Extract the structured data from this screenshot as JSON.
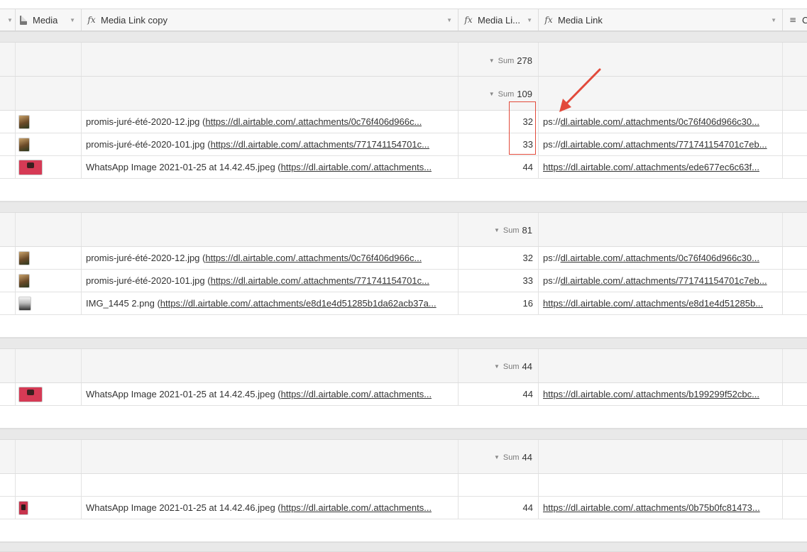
{
  "columns": {
    "media": "Media",
    "media_link_copy": "Media Link copy",
    "media_length": "Media Li...",
    "media_link": "Media Link",
    "last": "C"
  },
  "sum_label": "Sum",
  "groups": [
    {
      "sum": "278"
    },
    {
      "sum": "109",
      "rows": [
        {
          "name": "promis-juré-été-2020-12.jpg (",
          "link": "https://dl.airtable.com/.attachments/0c76f406d966c...",
          "length": "32",
          "media_link_prefix": "ps://",
          "media_link": "dl.airtable.com/.attachments/0c76f406d966c30..."
        },
        {
          "name": "promis-juré-été-2020-101.jpg (",
          "link": "https://dl.airtable.com/.attachments/771741154701c...",
          "length": "33",
          "media_link_prefix": "ps://",
          "media_link": "dl.airtable.com/.attachments/771741154701c7eb..."
        },
        {
          "name": "WhatsApp Image 2021-01-25 at 14.42.45.jpeg (",
          "link": "https://dl.airtable.com/.attachments...",
          "length": "44",
          "media_link_prefix": "",
          "media_link": "https://dl.airtable.com/.attachments/ede677ec6c63f..."
        }
      ]
    },
    {
      "sum": "81",
      "rows": [
        {
          "name": "promis-juré-été-2020-12.jpg (",
          "link": "https://dl.airtable.com/.attachments/0c76f406d966c...",
          "length": "32",
          "media_link_prefix": "ps://",
          "media_link": "dl.airtable.com/.attachments/0c76f406d966c30..."
        },
        {
          "name": "promis-juré-été-2020-101.jpg (",
          "link": "https://dl.airtable.com/.attachments/771741154701c...",
          "length": "33",
          "media_link_prefix": "ps://",
          "media_link": "dl.airtable.com/.attachments/771741154701c7eb..."
        },
        {
          "name": "IMG_1445 2.png (",
          "link": "https://dl.airtable.com/.attachments/e8d1e4d51285b1da62acb37a...",
          "length": "16",
          "media_link_prefix": "",
          "media_link": "https://dl.airtable.com/.attachments/e8d1e4d51285b..."
        }
      ]
    },
    {
      "sum": "44",
      "rows": [
        {
          "name": "WhatsApp Image 2021-01-25 at 14.42.45.jpeg (",
          "link": "https://dl.airtable.com/.attachments...",
          "length": "44",
          "media_link_prefix": "",
          "media_link": "https://dl.airtable.com/.attachments/b199299f52cbc..."
        }
      ]
    },
    {
      "sum": "44",
      "rows": [
        {
          "name": "WhatsApp Image 2021-01-25 at 14.42.46.jpeg (",
          "link": "https://dl.airtable.com/.attachments...",
          "length": "44",
          "media_link_prefix": "",
          "media_link": "https://dl.airtable.com/.attachments/0b75b0fc81473..."
        }
      ]
    }
  ],
  "icons": {
    "formula": "formula-icon",
    "attachment": "document-icon",
    "long_text": "long-text-icon"
  },
  "colors": {
    "annotation": "#e24a3b"
  }
}
